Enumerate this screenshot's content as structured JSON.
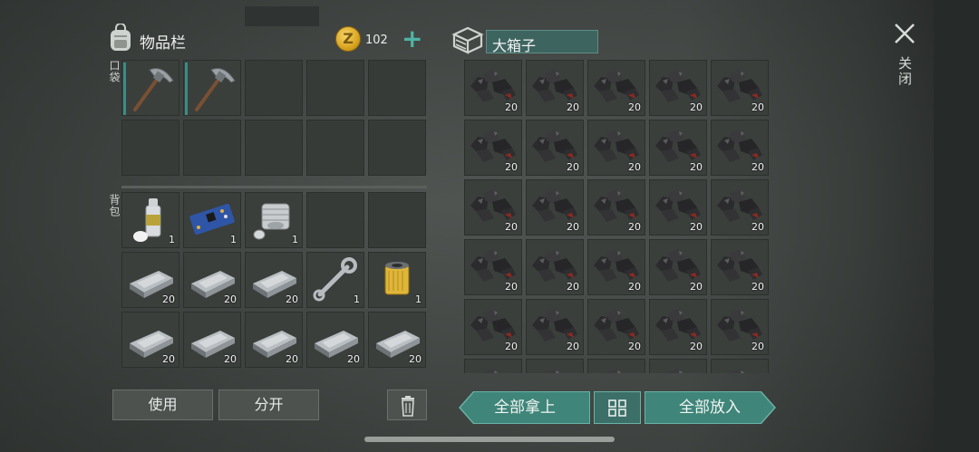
{
  "inventory": {
    "title": "物品栏",
    "coins": "102",
    "pocket_label": "口袋",
    "backpack_label": "背包",
    "pocket_slots": [
      {
        "icon": "pickaxe-icon",
        "qty": ""
      },
      {
        "icon": "pickaxe-icon",
        "qty": ""
      },
      {
        "icon": "",
        "qty": ""
      },
      {
        "icon": "",
        "qty": ""
      },
      {
        "icon": "",
        "qty": ""
      },
      {
        "icon": "",
        "qty": ""
      },
      {
        "icon": "",
        "qty": ""
      },
      {
        "icon": "",
        "qty": ""
      },
      {
        "icon": "",
        "qty": ""
      },
      {
        "icon": "",
        "qty": ""
      }
    ],
    "backpack_slots": [
      {
        "icon": "spray-can-icon",
        "qty": "1"
      },
      {
        "icon": "circuit-board-icon",
        "qty": "1"
      },
      {
        "icon": "engine-cylinder-icon",
        "qty": "1"
      },
      {
        "icon": "",
        "qty": ""
      },
      {
        "icon": "",
        "qty": ""
      },
      {
        "icon": "metal-ingot-icon",
        "qty": "20"
      },
      {
        "icon": "metal-ingot-icon",
        "qty": "20"
      },
      {
        "icon": "metal-ingot-icon",
        "qty": "20"
      },
      {
        "icon": "wrench-icon",
        "qty": "1"
      },
      {
        "icon": "oil-filter-icon",
        "qty": "1"
      },
      {
        "icon": "metal-ingot-icon",
        "qty": "20"
      },
      {
        "icon": "metal-ingot-icon",
        "qty": "20"
      },
      {
        "icon": "metal-ingot-icon",
        "qty": "20"
      },
      {
        "icon": "metal-ingot-icon",
        "qty": "20"
      },
      {
        "icon": "metal-ingot-icon",
        "qty": "20"
      }
    ],
    "use_label": "使用",
    "split_label": "分开"
  },
  "box": {
    "name": "大箱子",
    "slot_qty": "20",
    "slot_icon": "coal-icon"
  },
  "actions": {
    "take_all": "全部拿上",
    "put_all": "全部放入",
    "close": "关闭"
  },
  "colors": {
    "accent_teal": "#3f8579",
    "coin_gold": "#d9a520"
  }
}
